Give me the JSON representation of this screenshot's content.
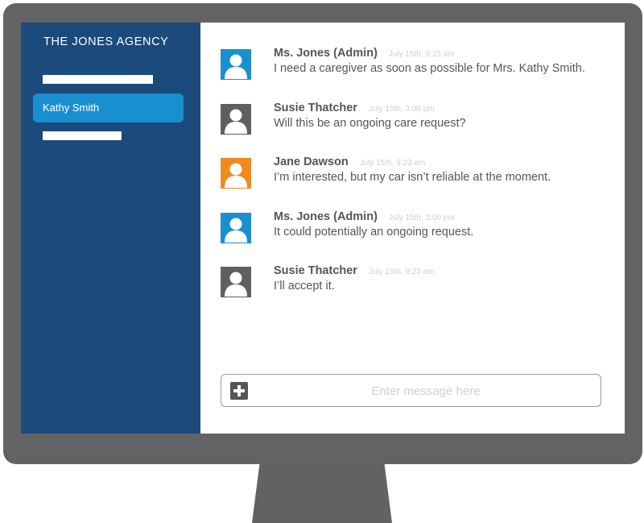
{
  "sidebar": {
    "title": "THE JONES AGENCY",
    "items": [
      {
        "label": "Kathy Smith",
        "selected": true
      }
    ]
  },
  "colors": {
    "sidebar_bg": "#1b4a7c",
    "selected_item": "#1a8fd0",
    "avatar_admin": "#1a8fd0",
    "avatar_default": "#5f5f61",
    "avatar_orange": "#ef8a1f",
    "bezel": "#636365"
  },
  "messages": [
    {
      "sender": "Ms. Jones (Admin)",
      "time": "July 15th, 9:23 am",
      "text": "I need a caregiver as soon as possible for Mrs. Kathy Smith.",
      "avatar_color": "#1a8fd0",
      "avatar_icon": "user-icon"
    },
    {
      "sender": "Susie Thatcher",
      "time": "July 15th, 3:00 pm",
      "text": "Will this be an ongoing care request?",
      "avatar_color": "#5f5f61",
      "avatar_icon": "user-icon"
    },
    {
      "sender": "Jane Dawson",
      "time": "July 15th, 9:23 am",
      "text": "I’m interested, but my car isn’t reliable at the moment.",
      "avatar_color": "#ef8a1f",
      "avatar_icon": "user-icon"
    },
    {
      "sender": "Ms. Jones (Admin)",
      "time": "July 15th, 3:00 pm",
      "text": "It could potentially an ongoing request.",
      "avatar_color": "#1a8fd0",
      "avatar_icon": "user-icon"
    },
    {
      "sender": "Susie Thatcher",
      "time": "July 15th, 9:23 am",
      "text": "I’ll accept it.",
      "avatar_color": "#5f5f61",
      "avatar_icon": "user-icon"
    }
  ],
  "composer": {
    "placeholder": "Enter message here",
    "value": "",
    "add_icon": "plus-icon"
  }
}
